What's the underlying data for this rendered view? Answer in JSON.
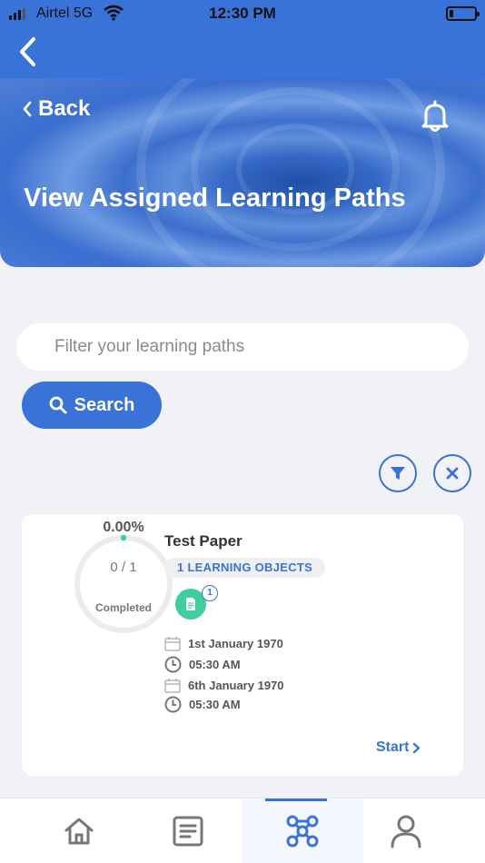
{
  "status_bar": {
    "carrier": "Airtel 5G",
    "time": "12:30 PM"
  },
  "header": {
    "back_label": "Back",
    "title": "View Assigned Learning Paths"
  },
  "search": {
    "placeholder": "Filter your learning paths",
    "button_label": "Search"
  },
  "learning_path_card": {
    "progress_percent": "0.00%",
    "progress_fraction": "0 / 1",
    "progress_caption": "Completed",
    "title": "Test Paper",
    "objects_badge": "1 LEARNING OBJECTS",
    "document_count": "1",
    "start_date": "1st January 1970",
    "start_time": "05:30 AM",
    "end_date": "6th January 1970",
    "end_time": "05:30 AM",
    "action_label": "Start"
  },
  "bottom_nav": [
    "home-icon",
    "document-icon",
    "learning-paths-icon",
    "profile-icon"
  ],
  "colors": {
    "primary": "#3a73d8",
    "accent_green": "#3fcf9c",
    "background": "#f1f2f7"
  }
}
